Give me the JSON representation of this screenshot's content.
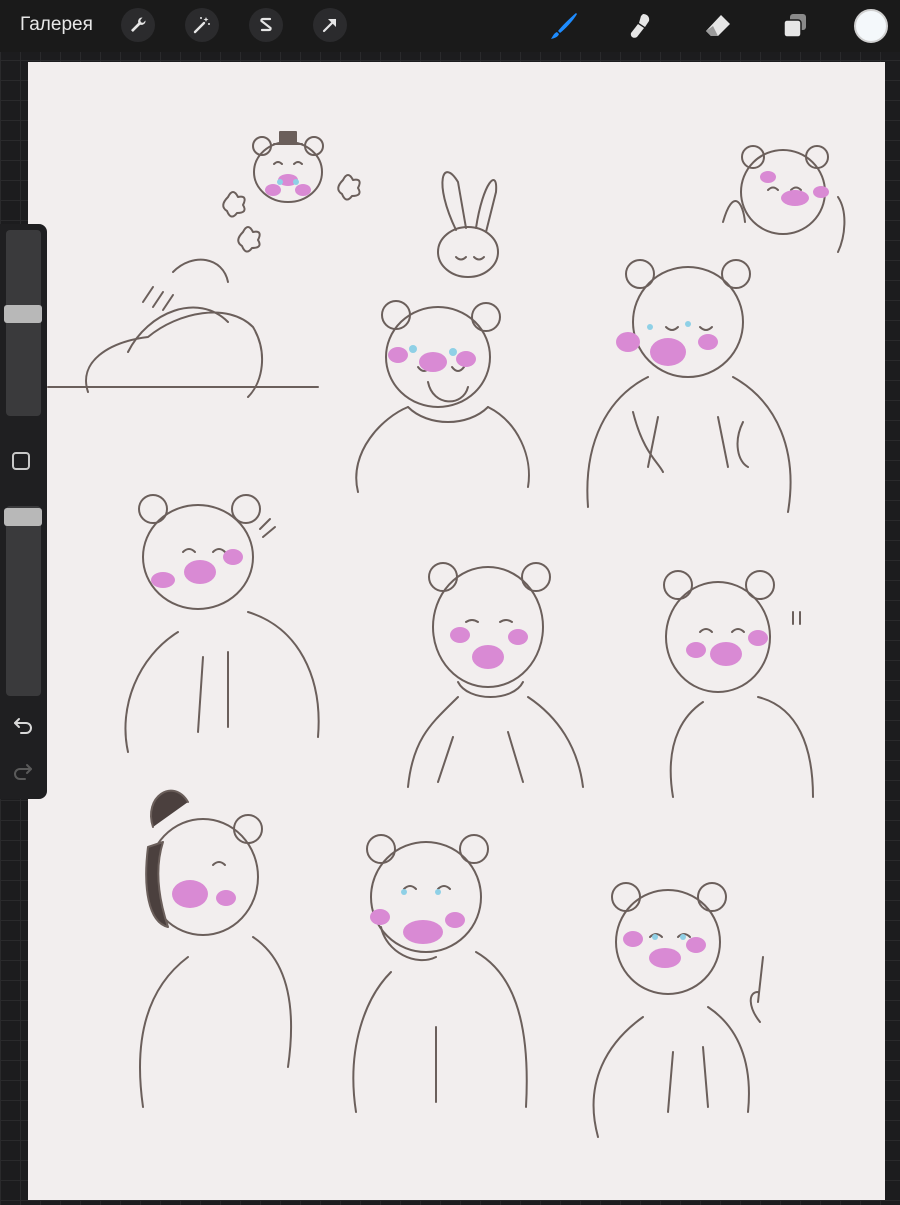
{
  "topbar": {
    "gallery_label": "Галерея",
    "left_tools": [
      "wrench-icon",
      "magic-wand-icon",
      "selection-icon",
      "transform-arrow-icon"
    ],
    "right_tools": [
      "brush-icon",
      "smudge-icon",
      "eraser-icon",
      "layers-icon"
    ],
    "active_tool": "brush-icon",
    "current_color": "#f4f8fb",
    "accent": "#1e8cff"
  },
  "sidebar": {
    "brush_size_level": 0.55,
    "opacity_level": 0.0,
    "tools": [
      "square-icon",
      "undo-icon",
      "redo-icon"
    ]
  },
  "canvas": {
    "background": "#f2eeee",
    "content": "sketch-sheet-bear-characters",
    "line_color": "#6b5f5b",
    "blush_color": "#d98ad4"
  }
}
